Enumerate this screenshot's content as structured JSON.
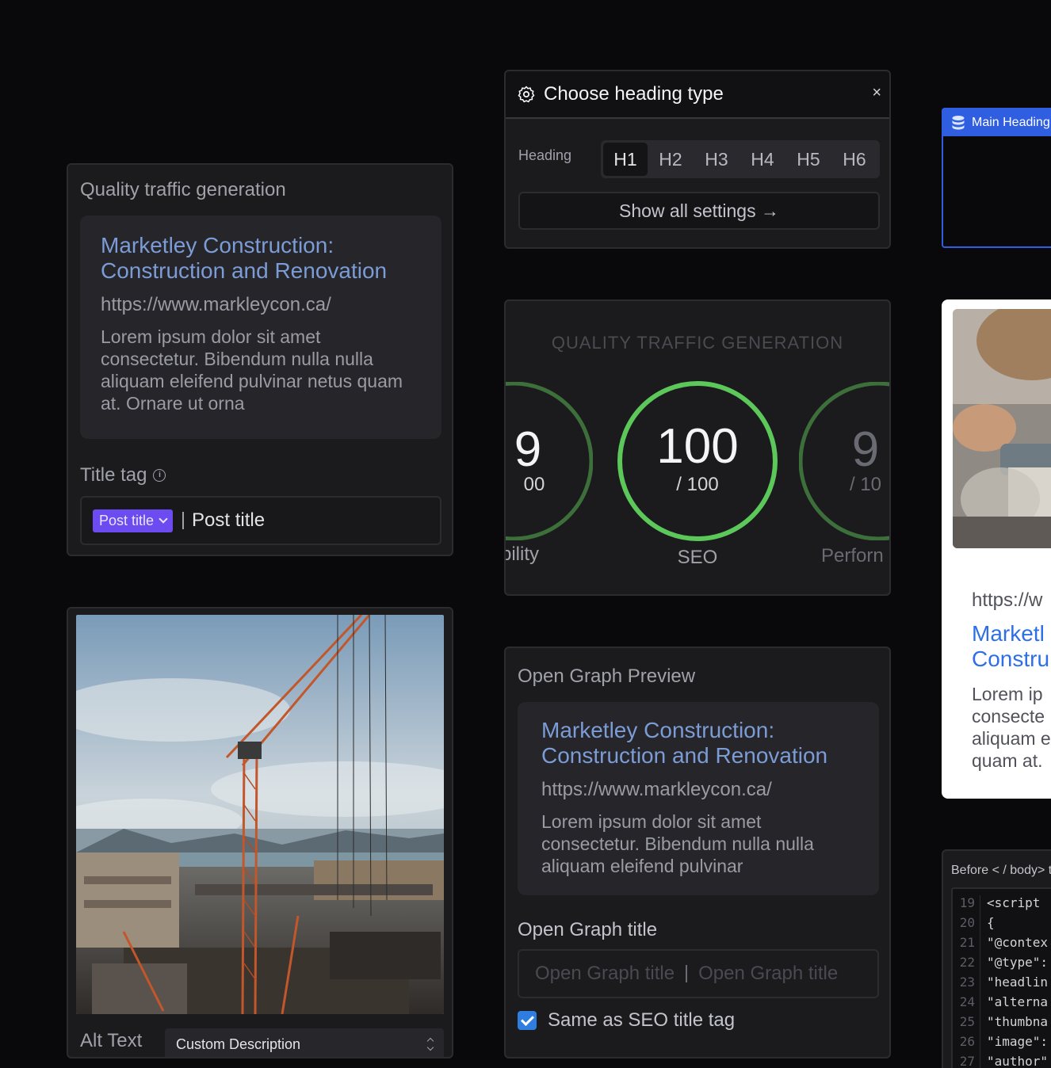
{
  "quality": {
    "title": "Quality traffic generation",
    "serp_title": "Marketley Construction: Construction and Renovation",
    "serp_url": "https://www.markleycon.ca/",
    "serp_desc": "Lorem ipsum dolor sit amet consectetur. Bibendum nulla nulla aliquam eleifend pulvinar netus quam at. Ornare ut orna",
    "title_tag_label": "Title tag",
    "title_tag_chip": "Post title",
    "title_tag_value": "Post title"
  },
  "image_panel": {
    "alt_label": "Alt Text",
    "alt_value": "Custom Description"
  },
  "heading_type": {
    "title": "Choose heading type",
    "heading_label": "Heading",
    "options": [
      "H1",
      "H2",
      "H3",
      "H4",
      "H5",
      "H6"
    ],
    "selected": "H1",
    "show_all": "Show all settings →",
    "close": "×"
  },
  "scores": {
    "title": "QUALITY TRAFFIC GENERATION",
    "gauges": [
      {
        "label": "bility",
        "value": "9",
        "max": "00"
      },
      {
        "label": "SEO",
        "value": "100",
        "max": "/ 100"
      },
      {
        "label": "Perforn",
        "value": "9",
        "max": "/ 10"
      }
    ]
  },
  "open_graph": {
    "title": "Open Graph Preview",
    "preview_title": "Marketley Construction: Construction and Renovation",
    "preview_url": "https://www.markleycon.ca/",
    "preview_desc": "Lorem ipsum dolor sit amet consectetur. Bibendum nulla nulla aliquam eleifend pulvinar",
    "og_title_label": "Open Graph title",
    "og_title_placeholder_1": "Open Graph title",
    "og_title_placeholder_2": "Open Graph title",
    "same_as_seo": "Same as SEO title tag",
    "same_as_seo_checked": true
  },
  "right": {
    "main_heading_tab": "Main Heading",
    "card_url": "https://w",
    "card_title": "Marketl Constru",
    "card_title_line1": "Marketl",
    "card_title_line2": "Constru",
    "card_desc_lines": [
      "Lorem ip",
      "consecte",
      "aliquam e",
      "quam at."
    ],
    "code_label": "Before < / body> t",
    "code_lines": [
      {
        "n": "19",
        "t": "<script"
      },
      {
        "n": "20",
        "t": "{"
      },
      {
        "n": "21",
        "t": "\"@contex"
      },
      {
        "n": "22",
        "t": "\"@type\":"
      },
      {
        "n": "23",
        "t": "\"headlin"
      },
      {
        "n": "24",
        "t": "\"alterna"
      },
      {
        "n": "25",
        "t": "\"thumbna"
      },
      {
        "n": "26",
        "t": "\"image\":"
      },
      {
        "n": "27",
        "t": "\"author\""
      }
    ]
  },
  "colors": {
    "accent_purple": "#6c4cf0",
    "accent_blue": "#2f5fe0",
    "score_green": "#5cc85a",
    "link_blue": "#7b9cd6"
  }
}
